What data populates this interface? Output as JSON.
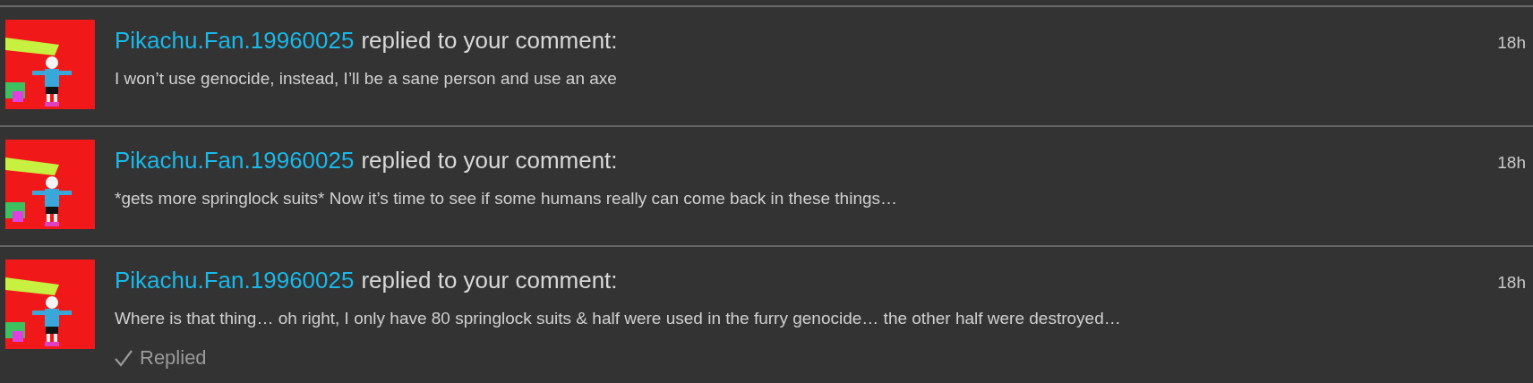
{
  "notifications": [
    {
      "user": "Pikachu.Fan.19960025",
      "action": "replied to your comment:",
      "time": "18h",
      "message": "I won’t use genocide, instead, I’ll be a sane person and use an axe",
      "replied": false
    },
    {
      "user": "Pikachu.Fan.19960025",
      "action": "replied to your comment:",
      "time": "18h",
      "message": "*gets more springlock suits* Now it’s time to see if some humans really can come back in these things…",
      "replied": false
    },
    {
      "user": "Pikachu.Fan.19960025",
      "action": "replied to your comment:",
      "time": "18h",
      "message": "Where is that thing… oh right, I only have 80 springlock suits & half were used in the furry genocide… the other half were destroyed…",
      "replied": true,
      "replied_label": "Replied"
    }
  ]
}
